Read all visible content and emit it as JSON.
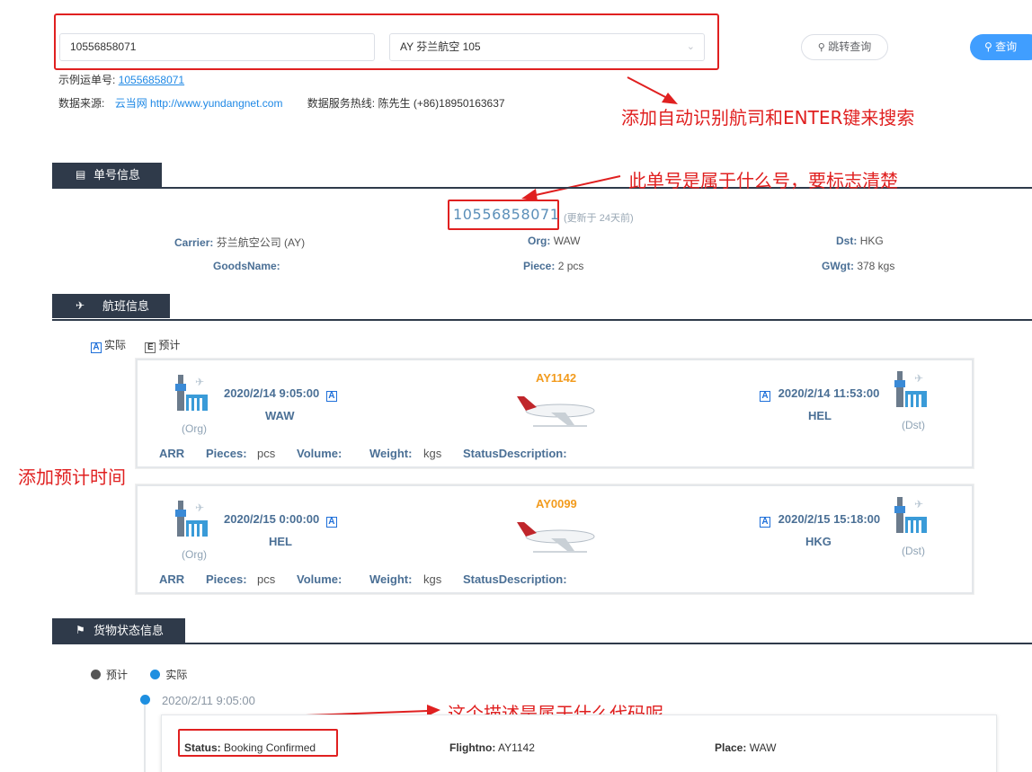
{
  "search": {
    "awb_value": "10556858071",
    "carrier_value": "AY 芬兰航空 105",
    "jump_label": "跳转查询",
    "query_label": "查询"
  },
  "example": {
    "label": "示例运单号:",
    "awb": "10556858071"
  },
  "source": {
    "label": "数据来源:",
    "name": "云当网 http://www.yundangnet.com",
    "hotline_label": "数据服务热线:",
    "hotline": "陈先生 (+86)18950163637"
  },
  "annotations": {
    "a1": "添加自动识别航司和ENTER键来搜索",
    "a2": "此单号是属于什么号，要标志清楚",
    "a3": "添加预计时间",
    "a4": "这个描述是属于什么代码呢"
  },
  "awb_section": {
    "title": "单号信息",
    "awb": "10556858071",
    "updated": "(更新于 24天前)",
    "carrier_k": "Carrier:",
    "carrier_v": "芬兰航空公司 (AY)",
    "org_k": "Org:",
    "org_v": "WAW",
    "dst_k": "Dst:",
    "dst_v": "HKG",
    "goods_k": "GoodsName:",
    "goods_v": "",
    "piece_k": "Piece:",
    "piece_v": "2 pcs",
    "gwgt_k": "GWgt:",
    "gwgt_v": "378 kgs"
  },
  "flight_section": {
    "title": "航班信息",
    "legend_actual": "实际",
    "legend_est": "预计",
    "badge_a": "A",
    "badge_e": "E",
    "org_label": "(Org)",
    "dst_label": "(Dst)",
    "row_labels": {
      "arr": "ARR",
      "pieces": "Pieces:",
      "pcs": "pcs",
      "volume": "Volume:",
      "weight": "Weight:",
      "kgs": "kgs",
      "status": "StatusDescription:"
    },
    "flights": [
      {
        "no": "AY1142",
        "dep_time": "2020/2/14 9:05:00",
        "dep_port": "WAW",
        "arr_time": "2020/2/14 11:53:00",
        "arr_port": "HEL"
      },
      {
        "no": "AY0099",
        "dep_time": "2020/2/15 0:00:00",
        "dep_port": "HEL",
        "arr_time": "2020/2/15 15:18:00",
        "arr_port": "HKG"
      }
    ]
  },
  "status_section": {
    "title": "货物状态信息",
    "legend_est": "预计",
    "legend_actual": "实际",
    "est_color": "#555555",
    "actual_color": "#1e8fe0",
    "entry": {
      "time": "2020/2/11 9:05:00",
      "status_k": "Status:",
      "status_v": "Booking Confirmed",
      "flight_k": "Flightno:",
      "flight_v": "AY1142",
      "place_k": "Place:",
      "place_v": "WAW"
    }
  },
  "colors": {
    "accent": "#409eff",
    "dark": "#2f3a4a",
    "highlight": "#e02020",
    "flight_no": "#f29b1d"
  }
}
